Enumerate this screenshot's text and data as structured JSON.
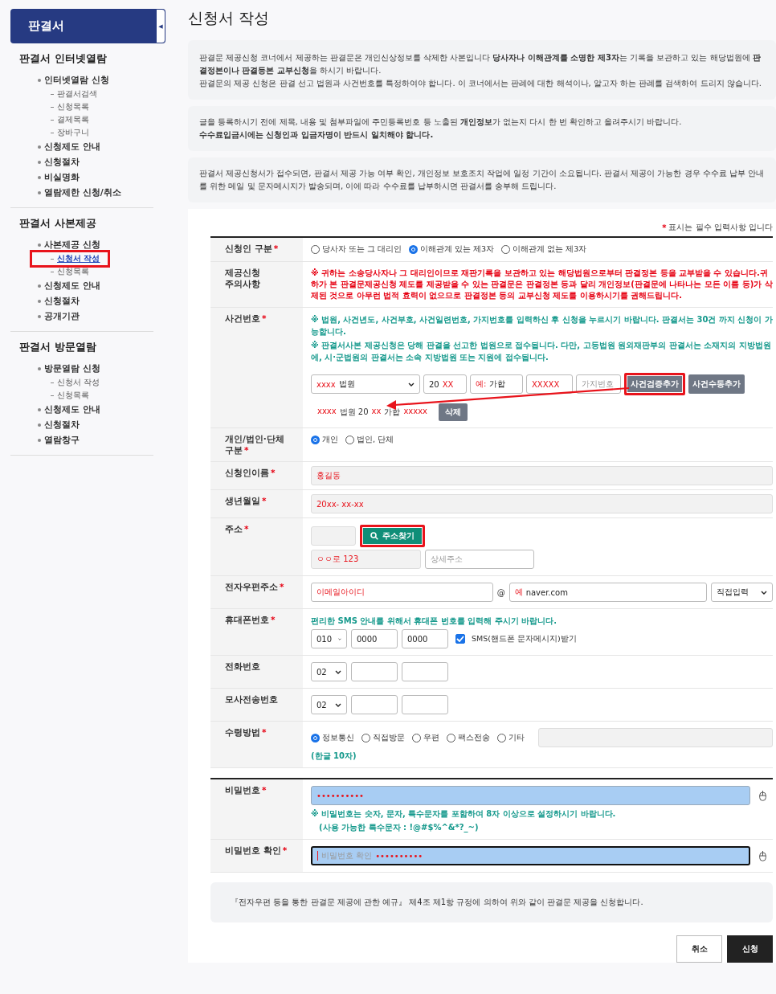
{
  "sidebar": {
    "title": "판결서",
    "toggle": "◀",
    "sections": [
      {
        "heading": "판결서 인터넷열람",
        "items": [
          {
            "label": "인터넷열람 신청",
            "selected": false,
            "children": [
              {
                "label": "판결서검색",
                "selected": false,
                "highlighted": false
              },
              {
                "label": "신청목록",
                "selected": false,
                "highlighted": false
              },
              {
                "label": "결제목록",
                "selected": false,
                "highlighted": false
              },
              {
                "label": "장바구니",
                "selected": false,
                "highlighted": false
              }
            ]
          },
          {
            "label": "신청제도 안내",
            "selected": false
          },
          {
            "label": "신청절차",
            "selected": false
          },
          {
            "label": "비실명화",
            "selected": false
          },
          {
            "label": "열람제한 신청/취소",
            "selected": false
          }
        ]
      },
      {
        "heading": "판결서 사본제공",
        "items": [
          {
            "label": "사본제공 신청",
            "selected": false,
            "children": [
              {
                "label": "신청서 작성",
                "selected": true,
                "highlighted": true
              },
              {
                "label": "신청목록",
                "selected": false,
                "highlighted": false
              }
            ]
          },
          {
            "label": "신청제도 안내",
            "selected": false
          },
          {
            "label": "신청절차",
            "selected": false
          },
          {
            "label": "공개기관",
            "selected": false
          }
        ]
      },
      {
        "heading": "판결서 방문열람",
        "items": [
          {
            "label": "방문열람 신청",
            "selected": false,
            "children": [
              {
                "label": "신청서 작성",
                "selected": false,
                "highlighted": false
              },
              {
                "label": "신청목록",
                "selected": false,
                "highlighted": false
              }
            ]
          },
          {
            "label": "신청제도 안내",
            "selected": false
          },
          {
            "label": "신청절차",
            "selected": false
          },
          {
            "label": "열람창구",
            "selected": false
          }
        ]
      }
    ]
  },
  "page_title": "신청서 작성",
  "notices": [
    {
      "paragraphs": [
        {
          "text": "판결문 제공신청 코너에서 제공하는 판결문은 개인신상정보를 삭제한 사본입니다 **당사자나 이해관계를 소명한 제3자**는 기록을 보관하고 있는 해당법원에 **판결정본이나 판결등본 교부신청**을 하시기 바랍니다.",
          "emphasis": false
        },
        {
          "text": "판결문의 제공 신청은 판결 선고 법원과 사건번호를 특정하여야 합니다. 이 코너에서는 판례에 대한 해석이나, 알고자 하는 판례를 검색하여 드리지 않습니다.",
          "emphasis": false
        }
      ]
    },
    {
      "paragraphs": [
        {
          "text": "글을 등록하시기 전에 제목, 내용 및 첨부파일에 주민등록번호 등 노출된 **개인정보**가 없는지 다시 한 번 확인하고 올려주시기 바랍니다.",
          "emphasis": false
        },
        {
          "text": "수수료입금시에는 신청인과 입금자명이 반드시 일치해야 합니다.",
          "emphasis": true
        }
      ]
    },
    {
      "paragraphs": [
        {
          "text": "판결서 제공신청서가 접수되면, 판결서 제공 가능 여부 확인, 개인정보 보호조치 작업에 일정 기간이 소요됩니다. 판결서 제공이 가능한 경우 수수료 납부 안내를 위한 메일 및 문자메시지가 발송되며, 이에 따라 수수료를 납부하시면 판결서를 송부해 드립니다.",
          "emphasis": false
        }
      ]
    }
  ],
  "form": {
    "legend": {
      "mark": "*",
      "text": "표시는 필수 입력사항 입니다"
    },
    "groups": [
      {
        "rows": [
          {
            "kind": "radio",
            "label": "신청인 구분",
            "required": true,
            "options": [
              {
                "label": "당사자 또는 그 대리인",
                "selected": false
              },
              {
                "label": "이해관계 있는 제3자",
                "selected": true
              },
              {
                "label": "이해관계 없는 제3자",
                "selected": false
              }
            ]
          },
          {
            "kind": "notice",
            "label": "제공신청 주의사항",
            "required": false,
            "text": "※ 귀하는 소송당사자나 그 대리인이므로 재판기록을 보관하고 있는 해당법원으로부터 판결정본 등을 교부받을 수 있습니다.귀하가 본 판결문제공신청 제도를 제공받을 수 있는 판결문은 판결정본 등과 달리 개인정보(판결문에 나타나는 모든 이름 등)가 삭제된 것으로 아무런 법적 효력이 없으므로 판결정본 등의 교부신청 제도를 이용하시기를 권해드립니다."
          },
          {
            "kind": "case",
            "label": "사건번호",
            "required": true,
            "notes": [
              "※ 법원, 사건년도, 사건부호, 사건일련번호, 가지번호를 입력하신 후 신청을 누르시기 바랍니다. 판결서는 30건 까지 신청이 가능합니다.",
              "※ 판결서사본 제공신청은 당해 판결을 선고한 법원으로 접수됩니다. 다만, 고등법원 원외재판부의 판결서는 소재지의 지방법원에, 시·군법원의 판결서는 소속 지방법원 또는 지원에 접수됩니다."
            ],
            "inputs": [
              {
                "kind": "select",
                "parts": [
                  {
                    "text": "xxxx",
                    "redacted": true
                  },
                  {
                    "text": "법원",
                    "redacted": false
                  }
                ]
              },
              {
                "kind": "text",
                "parts": [
                  {
                    "text": "20",
                    "redacted": false
                  },
                  {
                    "text": "XX",
                    "redacted": true
                  }
                ]
              },
              {
                "kind": "text",
                "parts": [
                  {
                    "text": "예:",
                    "redacted": true
                  },
                  {
                    "text": "가합",
                    "redacted": false
                  }
                ]
              },
              {
                "kind": "text",
                "parts": [
                  {
                    "text": "XXXXX",
                    "redacted": true
                  }
                ]
              },
              {
                "kind": "text",
                "placeholder": "가지번호"
              }
            ],
            "buttons": [
              {
                "label": "사건검증추가",
                "highlighted": true
              },
              {
                "label": "사건수동추가",
                "highlighted": false
              }
            ],
            "arrow": true,
            "entries": [
              {
                "parts": [
                  {
                    "text": "xxxx",
                    "redacted": true
                  },
                  {
                    "text": "법원 20",
                    "redacted": false
                  },
                  {
                    "text": "xx",
                    "redacted": true
                  },
                  {
                    "text": "가합",
                    "redacted": false
                  },
                  {
                    "text": "xxxxx",
                    "redacted": true
                  }
                ],
                "delete": "삭제"
              }
            ]
          },
          {
            "kind": "radio",
            "label": "개인/법인·단체 구분",
            "required": true,
            "options": [
              {
                "label": "개인",
                "selected": true
              },
              {
                "label": "법인, 단체",
                "selected": false
              }
            ]
          },
          {
            "kind": "field",
            "label": "신청인이름",
            "required": true,
            "field": {
              "readonly": true,
              "parts": [
                {
                  "text": "홍길동",
                  "redacted": true
                }
              ]
            }
          },
          {
            "kind": "field",
            "label": "생년월일",
            "required": true,
            "field": {
              "readonly": true,
              "parts": [
                {
                  "text": "20xx- xx-xx",
                  "redacted": true
                }
              ]
            }
          },
          {
            "kind": "address",
            "label": "주소",
            "required": true,
            "zip_field": {
              "readonly": true
            },
            "search_button": {
              "label": "주소찾기",
              "highlighted": true
            },
            "road_field": {
              "readonly": true,
              "parts": [
                {
                  "text": "ㅇㅇ로 123",
                  "redacted": true
                }
              ]
            },
            "detail_field": {
              "placeholder": "상세주소"
            }
          },
          {
            "kind": "email",
            "label": "전자우편주소",
            "required": true,
            "at": "@",
            "fields": [
              {
                "kind": "text",
                "parts": [
                  {
                    "text": "이메일아이디",
                    "redacted": true
                  }
                ]
              },
              {
                "kind": "text",
                "parts": [
                  {
                    "text": "예",
                    "redacted": true
                  },
                  {
                    "text": "naver.com",
                    "redacted": false
                  }
                ]
              },
              {
                "kind": "select",
                "parts": [
                  {
                    "text": "직접입력",
                    "redacted": false
                  }
                ]
              }
            ]
          },
          {
            "kind": "phone",
            "label": "휴대폰번호",
            "required": true,
            "note": "편리한 SMS 안내를 위해서 휴대폰 번호를 입력해 주시기 바랍니다.",
            "fields": [
              {
                "kind": "select",
                "parts": [
                  {
                    "text": "010",
                    "redacted": false
                  }
                ]
              },
              {
                "kind": "text",
                "parts": [
                  {
                    "text": "0000",
                    "redacted": false
                  }
                ]
              },
              {
                "kind": "text",
                "parts": [
                  {
                    "text": "0000",
                    "redacted": false
                  }
                ]
              }
            ],
            "checkbox": {
              "label": "SMS(핸드폰 문자메시지)받기",
              "checked": true
            }
          },
          {
            "kind": "phone",
            "label": "전화번호",
            "required": false,
            "fields": [
              {
                "kind": "select",
                "parts": [
                  {
                    "text": "02",
                    "redacted": false
                  }
                ]
              },
              {
                "kind": "text"
              },
              {
                "kind": "text"
              }
            ]
          },
          {
            "kind": "phone",
            "label": "모사전송번호",
            "required": false,
            "fields": [
              {
                "kind": "select",
                "parts": [
                  {
                    "text": "02",
                    "redacted": false
                  }
                ]
              },
              {
                "kind": "text"
              },
              {
                "kind": "text"
              }
            ]
          },
          {
            "kind": "receipt",
            "label": "수령방법",
            "required": true,
            "options": [
              {
                "label": "정보통신",
                "selected": true
              },
              {
                "label": "직접방문",
                "selected": false
              },
              {
                "label": "우편",
                "selected": false
              },
              {
                "label": "팩스전송",
                "selected": false
              },
              {
                "label": "기타",
                "selected": false
              }
            ],
            "other_field": {
              "readonly": true
            },
            "note": "(한글 10자)"
          }
        ]
      },
      {
        "rows": [
          {
            "kind": "password",
            "label": "비밀번호",
            "required": true,
            "field": {
              "focused": false,
              "parts": [
                {
                  "text": "••••••••••",
                  "redacted": true
                }
              ]
            },
            "notes": [
              "※ 비밀번호는 숫자, 문자, 특수문자를 포함하여 8자 이상으로 설정하시기 바랍니다.",
              "(사용 가능한 특수문자 : !@#$%^&*?_~)"
            ]
          },
          {
            "kind": "password",
            "label": "비밀번호 확인",
            "required": true,
            "field": {
              "focused": true,
              "placeholder": "비밀번호 확인",
              "parts": [
                {
                  "text": "••••••••••",
                  "redacted": true
                }
              ]
            }
          }
        ]
      }
    ],
    "declaration": "『전자우편 등을 통한 판결문 제공에 관한 예규』 제4조 제1항 규정에 의하여 위와 같이 판결문 제공을 신청합니다.",
    "buttons": [
      {
        "label": "취소",
        "kind": "secondary"
      },
      {
        "label": "신청",
        "kind": "primary"
      }
    ]
  }
}
